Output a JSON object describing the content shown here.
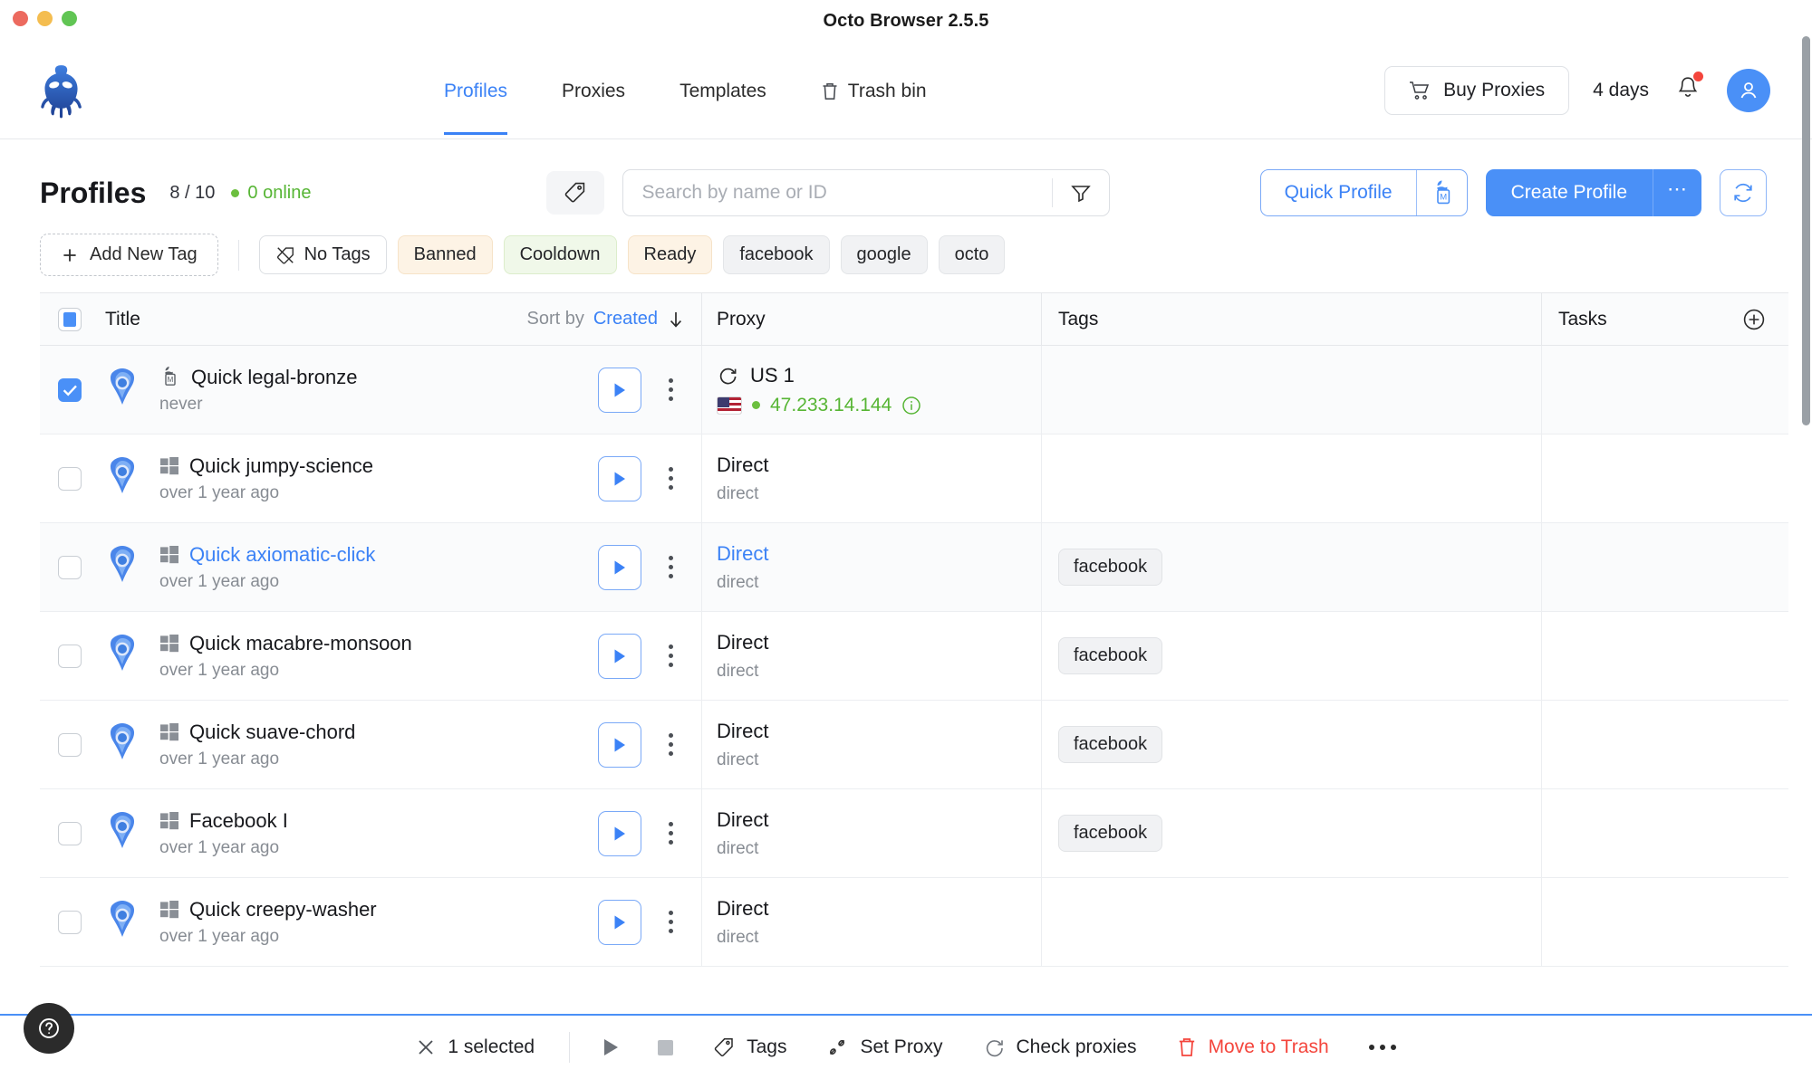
{
  "window": {
    "title": "Octo Browser 2.5.5",
    "traffic_lights": [
      "close",
      "minimize",
      "maximize"
    ]
  },
  "header": {
    "logo_name": "octo-browser-logo",
    "nav": [
      {
        "label": "Profiles",
        "active": true,
        "icon": ""
      },
      {
        "label": "Proxies",
        "active": false,
        "icon": ""
      },
      {
        "label": "Templates",
        "active": false,
        "icon": ""
      },
      {
        "label": "Trash bin",
        "active": false,
        "icon": "trash-icon"
      }
    ],
    "buy_proxies_label": "Buy Proxies",
    "days_label": "4 days",
    "notification_badge": true,
    "accent_color": "#4a90f7"
  },
  "toolbar": {
    "page_title": "Profiles",
    "counts": "8 / 10",
    "online": "0 online",
    "online_color": "#56b534",
    "search_placeholder": "Search by name or ID",
    "search_value": "",
    "quick_profile_label": "Quick Profile",
    "create_profile_label": "Create Profile",
    "create_more_label": "…"
  },
  "tags_bar": {
    "add_new_tag_label": "Add New Tag",
    "chips": [
      {
        "label": "No Tags",
        "style": "plain",
        "icon": "no-tags-icon"
      },
      {
        "label": "Banned",
        "style": "orange",
        "icon": ""
      },
      {
        "label": "Cooldown",
        "style": "green",
        "icon": ""
      },
      {
        "label": "Ready",
        "style": "orange",
        "icon": ""
      },
      {
        "label": "facebook",
        "style": "gray",
        "icon": ""
      },
      {
        "label": "google",
        "style": "gray",
        "icon": ""
      },
      {
        "label": "octo",
        "style": "gray",
        "icon": ""
      }
    ]
  },
  "table": {
    "headers": {
      "title": "Title",
      "sort_by_label": "Sort by",
      "sort_key": "Created",
      "sort_direction": "desc",
      "proxy": "Proxy",
      "tags": "Tags",
      "tasks": "Tasks"
    },
    "rows": [
      {
        "selected": true,
        "highlight": true,
        "os": "mac",
        "name": "Quick legal-bronze",
        "name_link": false,
        "last_run": "never",
        "proxy_name": "US 1",
        "proxy_name_link": false,
        "proxy_sub": "",
        "proxy_has_spinner": true,
        "proxy_ip": "47.233.14.144",
        "proxy_flag": "us",
        "tags": []
      },
      {
        "selected": false,
        "highlight": false,
        "os": "windows",
        "name": "Quick jumpy-science",
        "name_link": false,
        "last_run": "over 1 year ago",
        "proxy_name": "Direct",
        "proxy_name_link": false,
        "proxy_sub": "direct",
        "proxy_has_spinner": false,
        "proxy_ip": "",
        "proxy_flag": "",
        "tags": []
      },
      {
        "selected": false,
        "highlight": true,
        "os": "windows",
        "name": "Quick axiomatic-click",
        "name_link": true,
        "last_run": "over 1 year ago",
        "proxy_name": "Direct",
        "proxy_name_link": true,
        "proxy_sub": "direct",
        "proxy_has_spinner": false,
        "proxy_ip": "",
        "proxy_flag": "",
        "tags": [
          "facebook"
        ]
      },
      {
        "selected": false,
        "highlight": false,
        "os": "windows",
        "name": "Quick macabre-monsoon",
        "name_link": false,
        "last_run": "over 1 year ago",
        "proxy_name": "Direct",
        "proxy_name_link": false,
        "proxy_sub": "direct",
        "proxy_has_spinner": false,
        "proxy_ip": "",
        "proxy_flag": "",
        "tags": [
          "facebook"
        ]
      },
      {
        "selected": false,
        "highlight": false,
        "os": "windows",
        "name": "Quick suave-chord",
        "name_link": false,
        "last_run": "over 1 year ago",
        "proxy_name": "Direct",
        "proxy_name_link": false,
        "proxy_sub": "direct",
        "proxy_has_spinner": false,
        "proxy_ip": "",
        "proxy_flag": "",
        "tags": [
          "facebook"
        ]
      },
      {
        "selected": false,
        "highlight": false,
        "os": "windows",
        "name": "Facebook I",
        "name_link": false,
        "last_run": "over 1 year ago",
        "proxy_name": "Direct",
        "proxy_name_link": false,
        "proxy_sub": "direct",
        "proxy_has_spinner": false,
        "proxy_ip": "",
        "proxy_flag": "",
        "tags": [
          "facebook"
        ]
      },
      {
        "selected": false,
        "highlight": false,
        "os": "windows",
        "name": "Quick creepy-washer",
        "name_link": false,
        "last_run": "over 1 year ago",
        "proxy_name": "Direct",
        "proxy_name_link": false,
        "proxy_sub": "direct",
        "proxy_has_spinner": false,
        "proxy_ip": "",
        "proxy_flag": "",
        "tags": []
      }
    ]
  },
  "bottom_bar": {
    "selected_label": "1 selected",
    "items": [
      {
        "label": "",
        "icon": "play-icon"
      },
      {
        "label": "",
        "icon": "stop-icon"
      },
      {
        "label": "Tags",
        "icon": "tag-icon"
      },
      {
        "label": "Set Proxy",
        "icon": "proxy-icon"
      },
      {
        "label": "Check proxies",
        "icon": "refresh-icon"
      },
      {
        "label": "Move to Trash",
        "icon": "trash-icon",
        "danger": true
      }
    ],
    "danger_color": "#f4453c"
  },
  "help_fab": {
    "name": "help-button",
    "glyph": "?"
  }
}
